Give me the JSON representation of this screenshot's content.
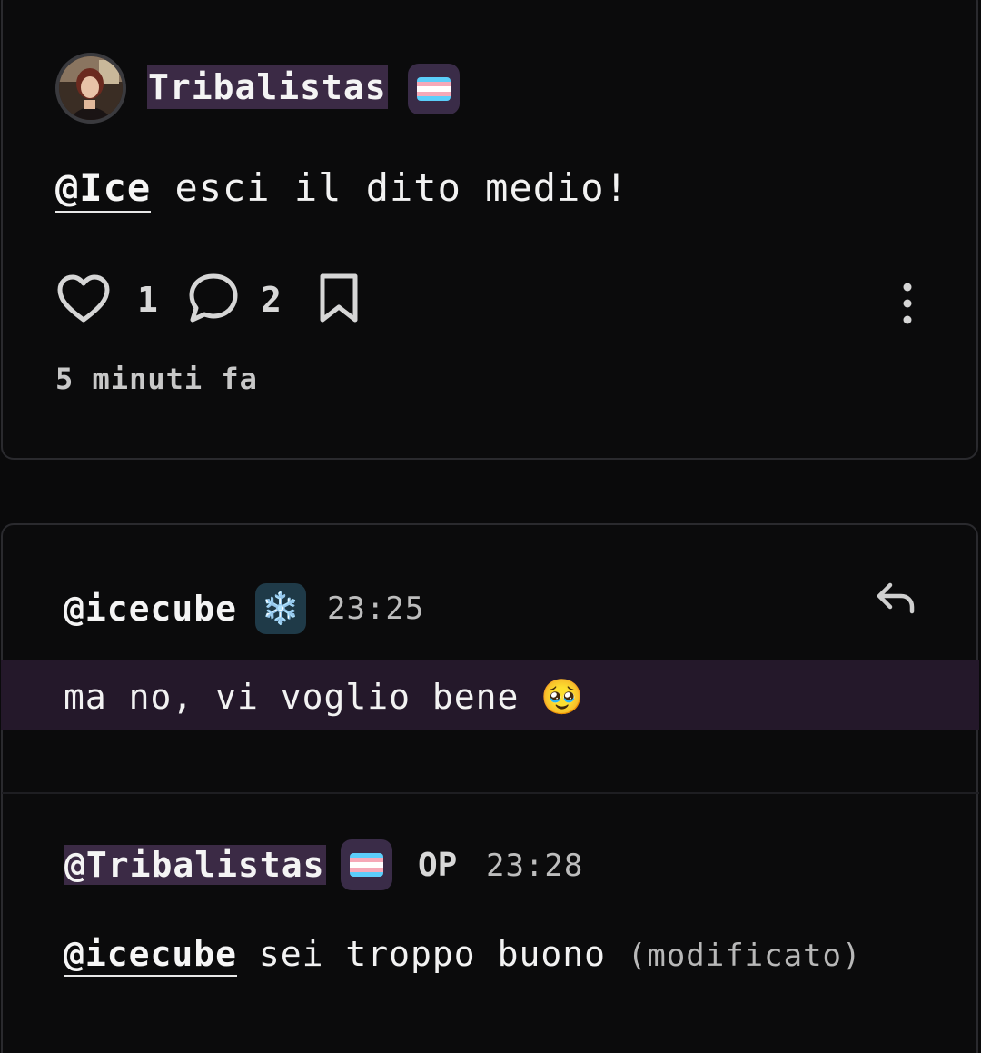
{
  "post": {
    "author": "Tribalistas",
    "author_badge_icon": "trans-flag-icon",
    "mention": "@Ice",
    "text": " esci il dito medio!",
    "likes": "1",
    "comments": "2",
    "time_ago": "5 minuti fa"
  },
  "comments": [
    {
      "author": "@icecube",
      "badge_icon": "snowflake-icon",
      "badge_glyph": "❄️",
      "time": "23:25",
      "text": "ma no, vi voglio bene",
      "emoji": "🥹"
    },
    {
      "author": "@Tribalistas",
      "badge_icon": "trans-flag-icon",
      "op_label": "OP",
      "time": "23:28",
      "mention": "@icecube",
      "text": " sei troppo buono ",
      "edited_label": "(modificato)"
    }
  ],
  "colors": {
    "background": "#0a0a0b",
    "highlight": "#24182a",
    "chip": "#3b2a45"
  }
}
